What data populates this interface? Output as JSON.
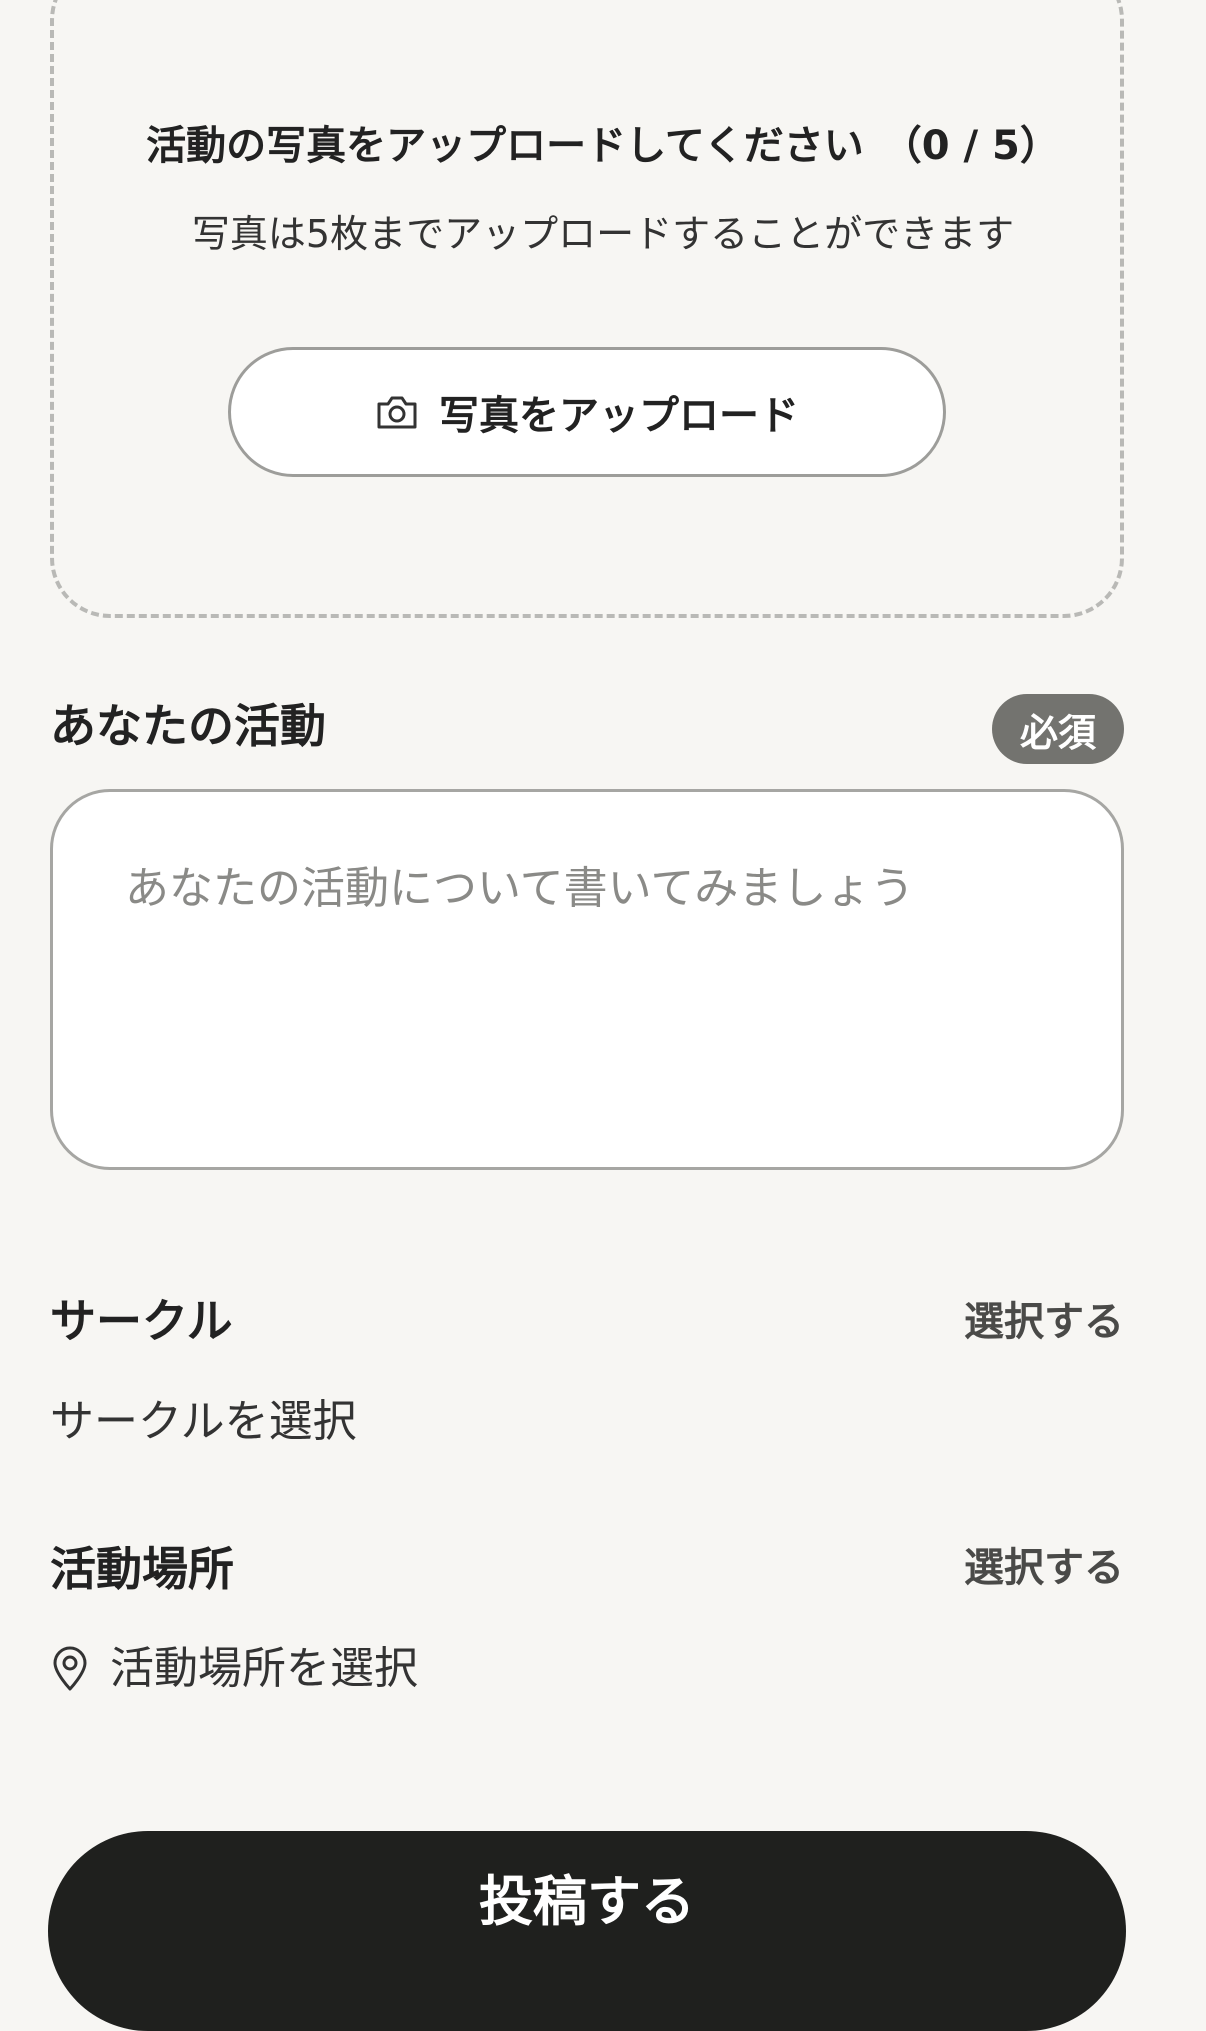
{
  "upload": {
    "title": "活動の写真をアップロードしてください",
    "count": "（0 / 5）",
    "subtitle": "写真は5枚までアップロードすることができます",
    "button_label": "写真をアップロード",
    "button_icon": "camera-icon"
  },
  "activity": {
    "label": "あなたの活動",
    "required_badge": "必須",
    "placeholder": "あなたの活動について書いてみましょう",
    "value": ""
  },
  "circle": {
    "label": "サークル",
    "select_link": "選択する",
    "value": "サークルを選択"
  },
  "location": {
    "label": "活動場所",
    "select_link": "選択する",
    "value": "活動場所を選択",
    "icon": "location-pin-icon"
  },
  "submit": {
    "label": "投稿する"
  },
  "colors": {
    "background": "#f7f6f3",
    "text": "#222222",
    "badge": "#73736f",
    "submit_background": "#1f201e",
    "dashed_border": "#b9b9b6"
  }
}
